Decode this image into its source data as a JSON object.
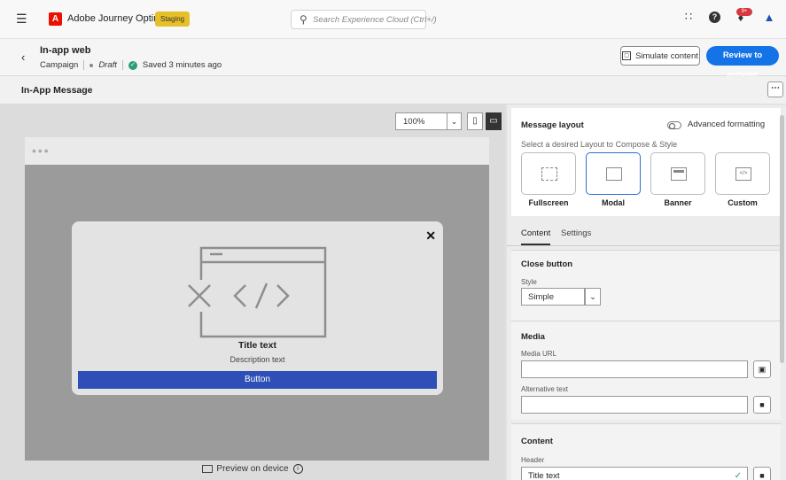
{
  "topbar": {
    "app_name": "Adobe Journey Optimizer",
    "environment": "Staging",
    "search_placeholder": "Search Experience Cloud (Ctrl+/)",
    "notification_count": "9+"
  },
  "campaign": {
    "title": "In-app web",
    "type": "Campaign",
    "status": "Draft",
    "saved_text": "Saved 3 minutes ago",
    "simulate_label": "Simulate content",
    "activate_label": "Review to activate"
  },
  "section": {
    "title": "In-App Message"
  },
  "preview": {
    "zoom": "100%",
    "modal_title": "Title text",
    "modal_description": "Description text",
    "modal_button": "Button",
    "preview_device_label": "Preview on device"
  },
  "layout": {
    "title": "Message layout",
    "advanced_label": "Advanced formatting",
    "advanced_enabled": false,
    "subtitle": "Select a desired Layout to Compose & Style",
    "options": [
      {
        "label": "Fullscreen",
        "icon": "fullscreen-layout-icon"
      },
      {
        "label": "Modal",
        "icon": "modal-layout-icon"
      },
      {
        "label": "Banner",
        "icon": "banner-layout-icon"
      },
      {
        "label": "Custom",
        "icon": "custom-layout-icon"
      }
    ],
    "selected": "Modal"
  },
  "tabs": [
    {
      "label": "Content",
      "active": true
    },
    {
      "label": "Settings",
      "active": false
    }
  ],
  "close_button": {
    "title": "Close button",
    "style_label": "Style",
    "style_value": "Simple"
  },
  "media": {
    "title": "Media",
    "url_label": "Media URL",
    "url_value": "",
    "alt_label": "Alternative text",
    "alt_value": ""
  },
  "content": {
    "title": "Content",
    "header_label": "Header",
    "header_value": "Title text"
  },
  "colors": {
    "accent_blue": "#1473e6",
    "modal_button": "#2d4fb7",
    "staging_badge": "#e6c028",
    "adobe_red": "#eb1000"
  }
}
